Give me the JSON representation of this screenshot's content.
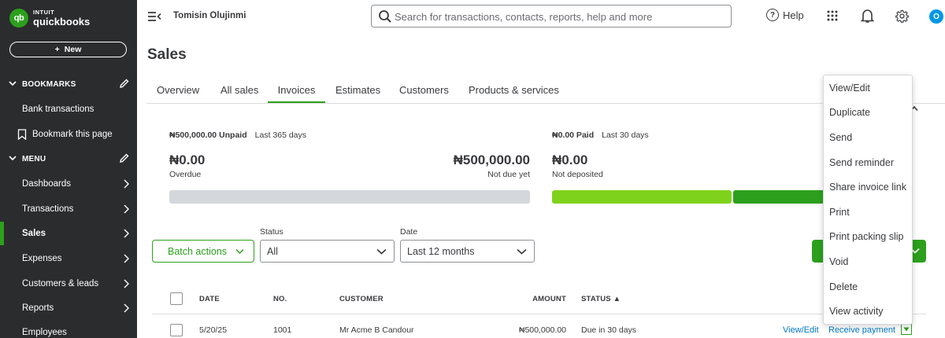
{
  "brand": {
    "intuit": "INTUIT",
    "product": "quickbooks",
    "mark": "qb"
  },
  "sidebar": {
    "new_label": "New",
    "bookmarks_label": "BOOKMARKS",
    "menu_label": "MENU",
    "bookmark_items": [
      "Bank transactions",
      "Bookmark this page"
    ],
    "menu_items": [
      "Dashboards",
      "Transactions",
      "Sales",
      "Expenses",
      "Customers & leads",
      "Reports",
      "Employees"
    ],
    "active_item": "Sales"
  },
  "header": {
    "user_name": "Tomisin Olujinmi",
    "search_placeholder": "Search for transactions, contacts, reports, help and more",
    "help_label": "Help",
    "avatar_letter": "O"
  },
  "page": {
    "title": "Sales",
    "tabs": [
      "Overview",
      "All sales",
      "Invoices",
      "Estimates",
      "Customers",
      "Products & services"
    ],
    "active_tab": "Invoices"
  },
  "summary": {
    "unpaid_amount": "₦500,000.00 Unpaid",
    "unpaid_period": "Last 365 days",
    "overdue_amount": "₦0.00",
    "overdue_label": "Overdue",
    "not_due_amount": "₦500,000.00",
    "not_due_label": "Not due yet",
    "paid_amount": "₦0.00 Paid",
    "paid_period": "Last 30 days",
    "not_deposited_amount": "₦0.00",
    "not_deposited_label": "Not deposited"
  },
  "filters": {
    "batch_actions": "Batch actions",
    "status_label": "Status",
    "status_value": "All",
    "date_label": "Date",
    "date_value": "Last 12 months"
  },
  "table": {
    "headers": {
      "date": "DATE",
      "no": "NO.",
      "customer": "CUSTOMER",
      "amount": "AMOUNT",
      "status": "STATUS ▲"
    },
    "rows": [
      {
        "date": "5/20/25",
        "no": "1001",
        "customer": "Mr Acme B Candour",
        "amount": "₦500,000.00",
        "status": "Due in 30 days",
        "action_view": "View/Edit",
        "action_receive": "Receive payment"
      }
    ]
  },
  "row_menu": {
    "items": [
      "View/Edit",
      "Duplicate",
      "Send",
      "Send reminder",
      "Share invoice link",
      "Print",
      "Print packing slip",
      "Void",
      "Delete",
      "View activity"
    ]
  },
  "colors": {
    "brand_green": "#2ca01c",
    "light_green": "#7fd21c",
    "sidebar_bg": "#2b2c2e",
    "link_blue": "#0077c5",
    "avatar_blue": "#0097e6"
  }
}
